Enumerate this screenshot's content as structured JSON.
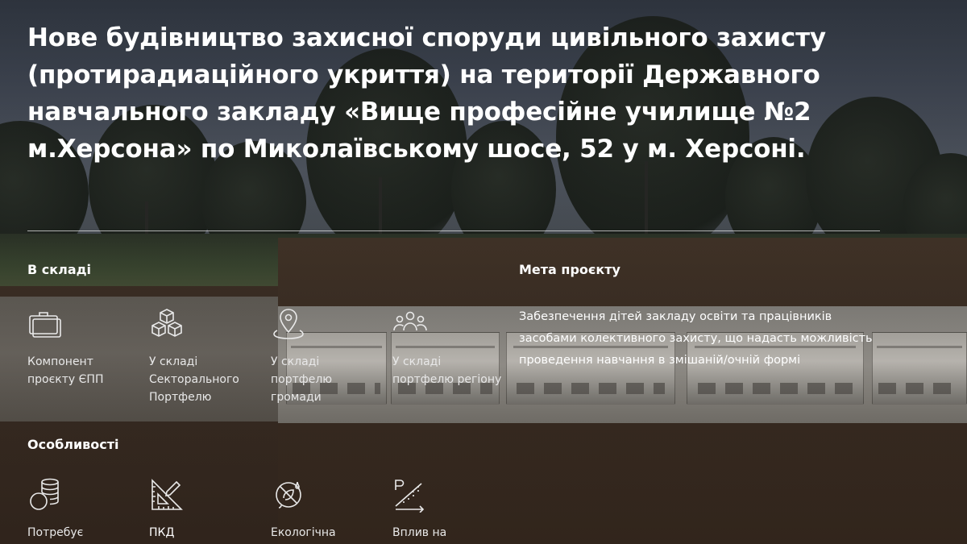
{
  "title": "Нове будівництво захисної споруди цивільного захисту (протирадиаційного укриття) на території Державного навчального закладу «Вище професійне училище №2 м.Херсона» по Миколаївському шосе, 52 у м. Херсоні.",
  "composition": {
    "heading": "В складі",
    "items": [
      {
        "icon": "briefcase-icon",
        "label": "Компонент проєкту ЄПП"
      },
      {
        "icon": "cubes-icon",
        "label": "У складі Секторального Портфелю"
      },
      {
        "icon": "location-pin-icon",
        "label": "У складі портфелю громади"
      },
      {
        "icon": "people-group-icon",
        "label": "У складі портфелю регіону"
      }
    ]
  },
  "goal": {
    "heading": "Мета проєкту",
    "text": "Забезпечення дітей закладу освіти та працівників засобами колективного захисту, що надасть можливість проведення навчання в змішаній/очній формі"
  },
  "features": {
    "heading": "Особливості",
    "items": [
      {
        "icon": "coins-icon",
        "label": "Потребує"
      },
      {
        "icon": "ruler-triangle-icon",
        "label": "ПКД"
      },
      {
        "icon": "eco-leaf-icon",
        "label": "Екологічна"
      },
      {
        "icon": "ramp-chart-icon",
        "label": "Вплив на"
      }
    ]
  },
  "colors": {
    "text": "#ffffff",
    "earth": "#3b2d23",
    "sky": "#4a5260"
  }
}
